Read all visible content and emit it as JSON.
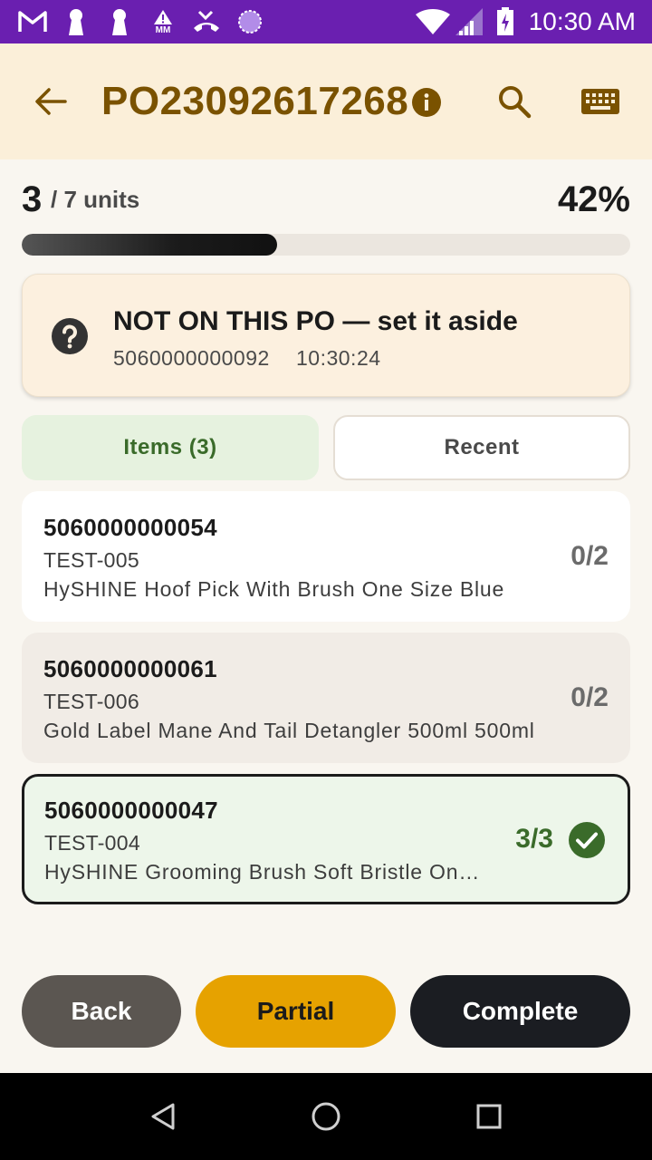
{
  "status_bar": {
    "time": "10:30 AM",
    "icons": [
      "gmail-icon",
      "keyhole-icon",
      "keyhole-icon",
      "mm-warning-icon",
      "missed-call-icon",
      "circle-icon",
      "wifi-icon",
      "signal-icon",
      "battery-charging-icon"
    ],
    "mm_label": "MM",
    "background": "#6a1fb0"
  },
  "header": {
    "title": "PO23092617268",
    "back_icon": "arrow-back-icon",
    "info_icon": "info-icon",
    "search_icon": "search-icon",
    "keyboard_icon": "keyboard-icon",
    "background": "#fbefd9",
    "title_color": "#7a5200"
  },
  "progress": {
    "scanned": "3",
    "total_label": "/ 7 units",
    "percent_label": "42%",
    "fraction": 0.42
  },
  "alert": {
    "icon": "help-circle-icon",
    "title": "NOT ON THIS PO — set it aside",
    "barcode": "5060000000092",
    "time": "10:30:24"
  },
  "tabs": [
    {
      "label": "Items (3)",
      "active": true
    },
    {
      "label": "Recent",
      "active": false
    }
  ],
  "items": [
    {
      "barcode": "5060000000054",
      "sku": "TEST-005",
      "description": "HySHINE Hoof Pick With Brush One Size Blue",
      "qty": "0/2",
      "complete": false
    },
    {
      "barcode": "5060000000061",
      "sku": "TEST-006",
      "description": "Gold Label Mane And Tail Detangler 500ml 500ml",
      "qty": "0/2",
      "complete": false
    },
    {
      "barcode": "5060000000047",
      "sku": "TEST-004",
      "description": "HySHINE Grooming Brush Soft Bristle One Size",
      "qty": "3/3",
      "complete": true
    }
  ],
  "actions": {
    "back_label": "Back",
    "partial_label": "Partial",
    "complete_label": "Complete"
  },
  "colors": {
    "accent_gold": "#e6a200",
    "success_green": "#3a6b2a",
    "dark": "#1b1d22"
  },
  "nav_bar": {
    "icons": [
      "nav-back-icon",
      "nav-home-icon",
      "nav-recents-icon"
    ]
  }
}
